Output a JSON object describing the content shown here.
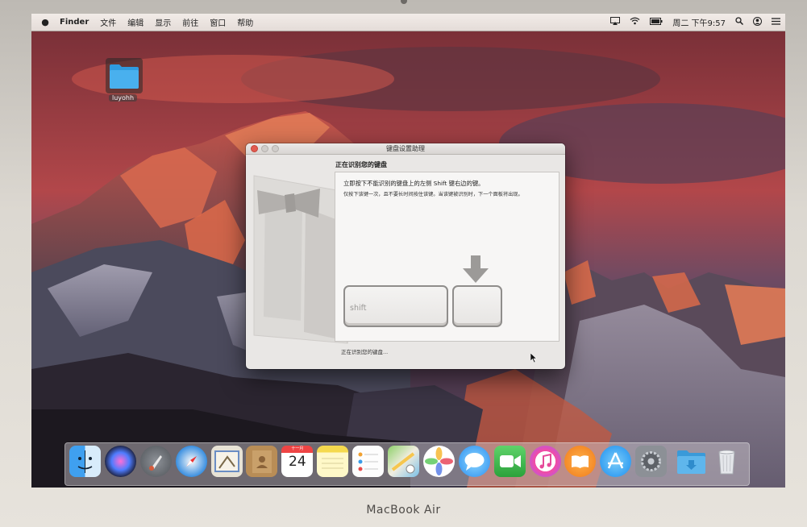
{
  "menubar": {
    "items": [
      "Finder",
      "文件",
      "编辑",
      "显示",
      "前往",
      "窗口",
      "帮助"
    ],
    "clock": "周二 下午9:57"
  },
  "desktop": {
    "folder_label": "luyohh"
  },
  "dialog": {
    "title": "键盘设置助理",
    "heading": "正在识别您的键盘",
    "instruction": "立即按下不能识别的键盘上的左侧 Shift 键右边的键。",
    "detail": "仅按下该键一次，且不要长时间按住该键。当该键被识别时，下一个面板将出现。",
    "shift_key_label": "shift",
    "status": "正在识别您的键盘..."
  },
  "dock": {
    "apps": [
      "Finder",
      "Siri",
      "Launchpad",
      "Safari",
      "Mail",
      "Contacts",
      "Calendar",
      "Notes",
      "Reminders",
      "Maps",
      "Photos",
      "Messages",
      "FaceTime",
      "iTunes",
      "iBooks",
      "App Store",
      "System Preferences",
      "Downloads",
      "Trash"
    ],
    "calendar_day": "24",
    "calendar_month": "十一月"
  },
  "device": {
    "brand": "MacBook Air"
  },
  "colors": {
    "menubar": "#ece5e1",
    "dialog_bg": "#e9e7e5",
    "close": "#e25b50",
    "dock_blue": "#3b8ee0"
  }
}
